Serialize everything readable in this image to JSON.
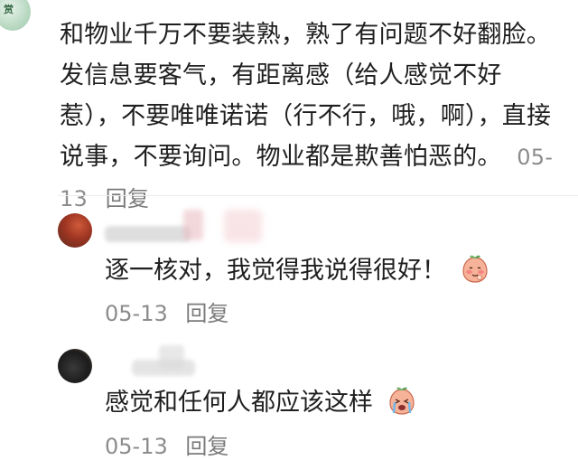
{
  "main_comment": {
    "text": "和物业千万不要装熟，熟了有问题不好翻脸。发信息要客气，有距离感（给人感觉不好惹），不要唯唯诺诺（行不行，哦，啊），直接说事，不要询问。物业都是欺善怕恶的。",
    "date": "05-13",
    "reply_label": "回复",
    "avatar_mark": "赏"
  },
  "replies": [
    {
      "text": "逐一核对，我觉得我说得很好！",
      "date": "05-13",
      "reply_label": "回复",
      "emoji": "blushing-peach-emoji"
    },
    {
      "text": "感觉和任何人都应该这样",
      "date": "05-13",
      "reply_label": "回复",
      "emoji": "crying-peach-emoji"
    }
  ],
  "colors": {
    "text": "#1f1f1f",
    "meta": "#8c8c8c",
    "background": "#ffffff"
  }
}
